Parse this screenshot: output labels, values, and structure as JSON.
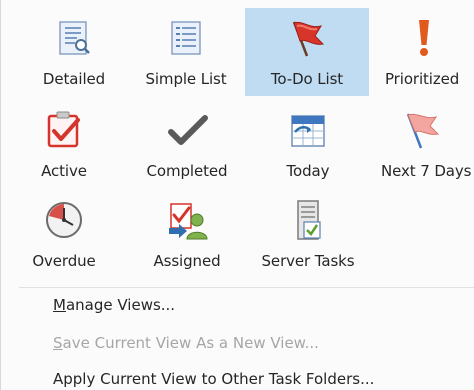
{
  "views": [
    {
      "label": "Detailed",
      "icon": "detailed-view-icon",
      "selected": false
    },
    {
      "label": "Simple List",
      "icon": "simple-list-icon",
      "selected": false
    },
    {
      "label": "To-Do List",
      "icon": "red-flag-icon",
      "selected": true
    },
    {
      "label": "Prioritized",
      "icon": "exclamation-icon",
      "selected": false
    },
    {
      "label": "Active",
      "icon": "checkbox-check-icon",
      "selected": false
    },
    {
      "label": "Completed",
      "icon": "checkmark-icon",
      "selected": false
    },
    {
      "label": "Today",
      "icon": "calendar-today-icon",
      "selected": false
    },
    {
      "label": "Next 7 Days",
      "icon": "pink-flag-icon",
      "selected": false
    },
    {
      "label": "Overdue",
      "icon": "clock-icon",
      "selected": false
    },
    {
      "label": "Assigned",
      "icon": "assigned-task-icon",
      "selected": false
    },
    {
      "label": "Server Tasks",
      "icon": "server-tasks-icon",
      "selected": false
    }
  ],
  "menu": {
    "manage_views": {
      "accel": "M",
      "rest": "anage Views..."
    },
    "save_view": {
      "accel": "S",
      "rest": "ave Current View As a New View...",
      "disabled": true
    },
    "apply_view": {
      "accel": "",
      "rest": "Apply Current View to Other Task Folders..."
    }
  },
  "colors": {
    "selected_bg": "#bfdcf3",
    "flag_red": "#d8352a",
    "check_red": "#d5342b",
    "disabled_text": "#a6a6a6"
  }
}
